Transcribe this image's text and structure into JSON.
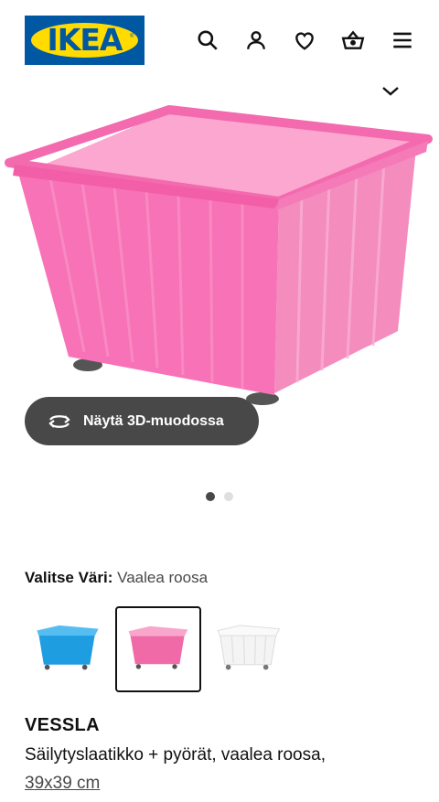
{
  "header": {
    "logo_text": "IKEA",
    "icons": [
      "search-icon",
      "user-icon",
      "heart-icon",
      "basket-icon",
      "menu-icon"
    ]
  },
  "product": {
    "view_3d_label": "Näytä 3D-muodossa",
    "gallery_position": 1,
    "gallery_count": 2,
    "color_prompt": "Valitse Väri:",
    "color_value": "Vaalea roosa",
    "color_options": [
      {
        "name": "Sininen",
        "hex": "#1e9de0"
      },
      {
        "name": "Vaalea roosa",
        "hex": "#f06aa8"
      },
      {
        "name": "Valkoinen",
        "hex": "#f4f4f4"
      }
    ],
    "selected_color_index": 1,
    "name": "VESSLA",
    "description": "Säilytyslaatikko + pyörät, vaalea roosa,",
    "size": "39x39 cm"
  },
  "colors": {
    "brand_blue": "#0058a3",
    "brand_yellow": "#ffdb00",
    "button_dark": "#484848",
    "crate_pink": "#f66fb0"
  }
}
